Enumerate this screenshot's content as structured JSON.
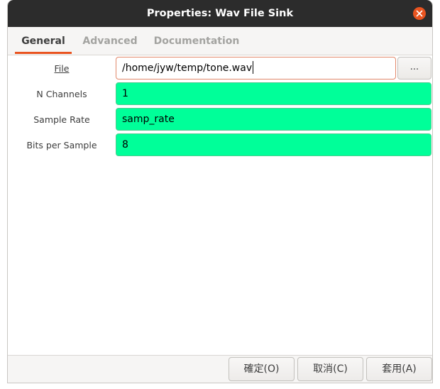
{
  "window": {
    "title": "Properties: Wav File Sink",
    "close_icon": "close-icon",
    "accent_color": "#e95420"
  },
  "tabs": [
    {
      "label": "General",
      "active": true
    },
    {
      "label": "Advanced",
      "active": false
    },
    {
      "label": "Documentation",
      "active": false
    }
  ],
  "params": {
    "file": {
      "label": "File",
      "value": "/home/jyw/temp/tone.wav",
      "browse_label": "..."
    },
    "n_channels": {
      "label": "N Channels",
      "value": "1"
    },
    "sample_rate": {
      "label": "Sample Rate",
      "value": "samp_rate"
    },
    "bits_per_sample": {
      "label": "Bits per Sample",
      "value": "8"
    }
  },
  "field_color": "#00ff99",
  "footer": {
    "ok_label": "確定(O)",
    "cancel_label": "取消(C)",
    "apply_label": "套用(A)"
  }
}
